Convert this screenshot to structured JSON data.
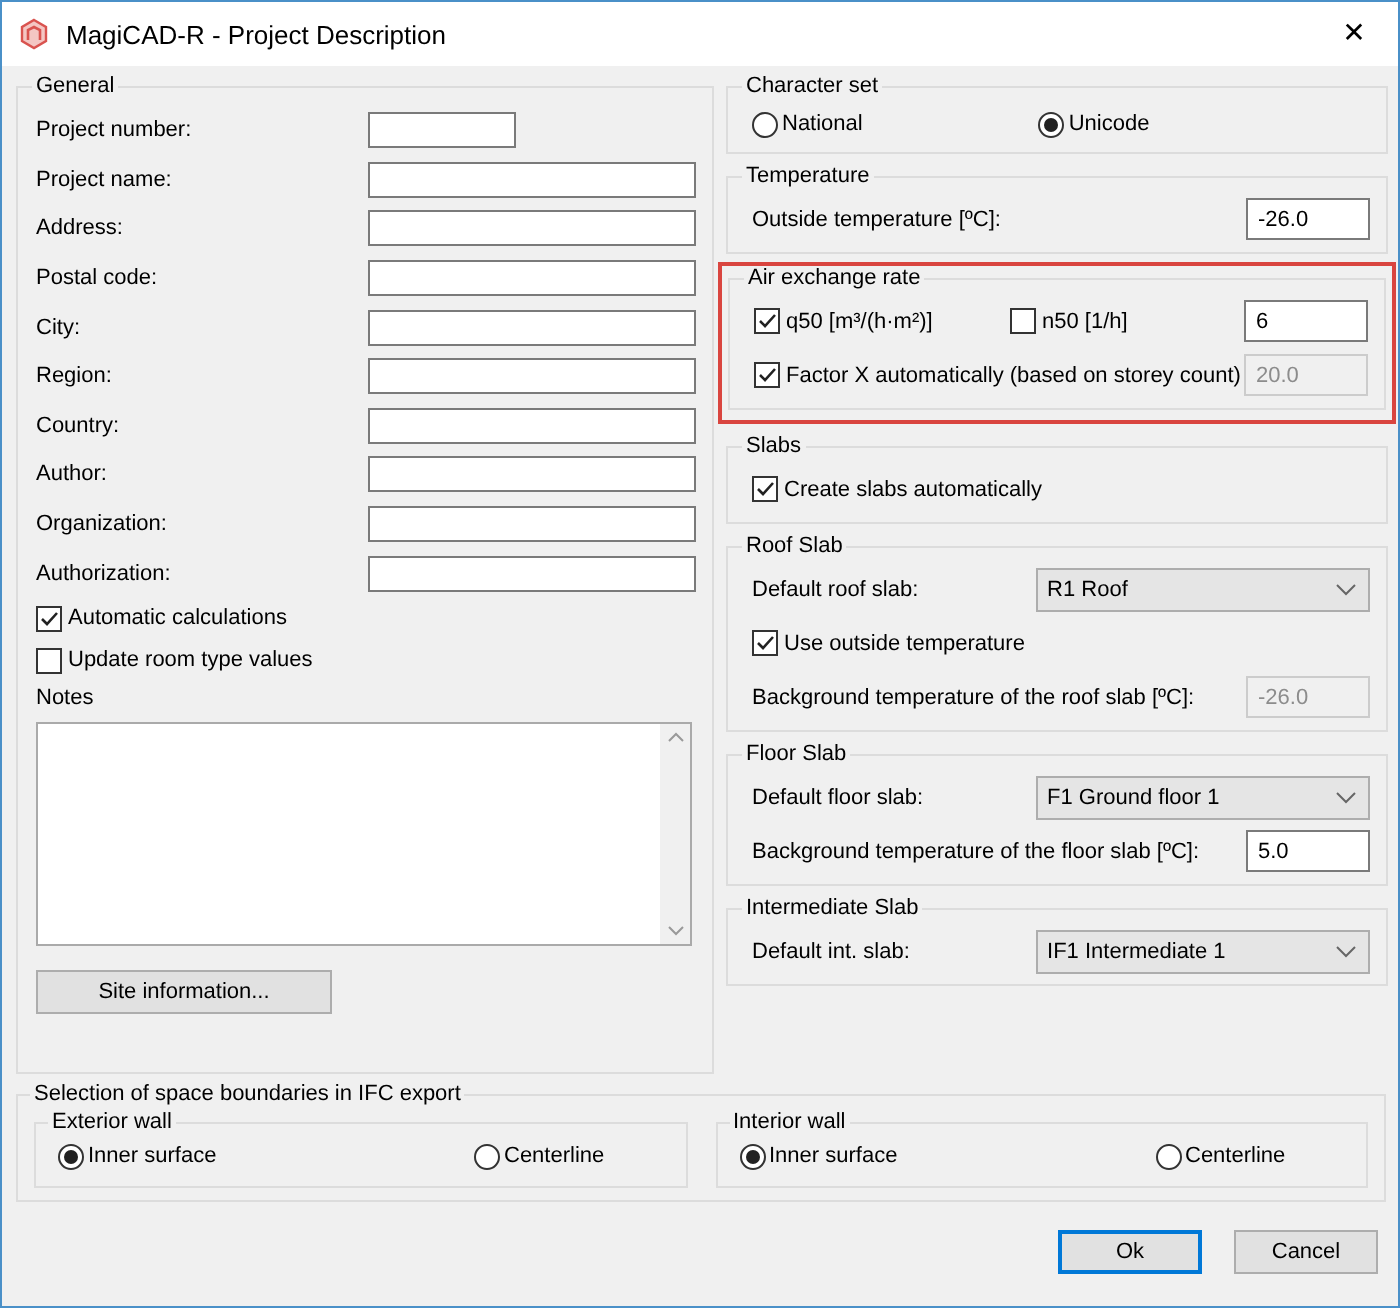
{
  "window": {
    "title": "MagiCAD-R - Project Description",
    "close": "✕"
  },
  "general": {
    "title": "General",
    "fields": [
      {
        "label": "Project number:",
        "short": true
      },
      {
        "label": "Project name:",
        "short": false
      },
      {
        "label": "Address:",
        "short": false
      },
      {
        "label": "Postal code:",
        "short": false
      },
      {
        "label": "City:",
        "short": false
      },
      {
        "label": "Region:",
        "short": false
      },
      {
        "label": "Country:",
        "short": false
      },
      {
        "label": "Author:",
        "short": false
      },
      {
        "label": "Organization:",
        "short": false
      },
      {
        "label": "Authorization:",
        "short": false
      }
    ],
    "checks": [
      {
        "label": "Automatic calculations",
        "checked": true
      },
      {
        "label": "Update room type values",
        "checked": false
      }
    ],
    "notes_label": "Notes",
    "site_button": "Site information..."
  },
  "groups": [
    {
      "title": "Character set",
      "highlighted": false,
      "rows": [
        {
          "kind": "radios",
          "options": [
            {
              "label": "National",
              "selected": false
            },
            {
              "label": "Unicode",
              "selected": true
            }
          ]
        }
      ]
    },
    {
      "title": "Temperature",
      "highlighted": false,
      "rows": [
        {
          "kind": "field",
          "label": "Outside temperature [ºC]:",
          "value": "-26.0",
          "disabled": false
        }
      ]
    },
    {
      "title": "Air exchange rate",
      "highlighted": true,
      "rows": [
        {
          "kind": "checks-field",
          "checks": [
            {
              "label": "q50 [m³/(h·m²)]",
              "checked": true
            },
            {
              "label": "n50 [1/h]",
              "checked": false
            }
          ],
          "value": "6",
          "disabled": false
        },
        {
          "kind": "check-field",
          "label": "Factor X automatically (based on storey count)",
          "checked": true,
          "value": "20.0",
          "disabled": true
        }
      ]
    },
    {
      "title": "Slabs",
      "highlighted": false,
      "rows": [
        {
          "kind": "check",
          "label": "Create slabs automatically",
          "checked": true
        }
      ]
    },
    {
      "title": "Roof Slab",
      "highlighted": false,
      "rows": [
        {
          "kind": "select",
          "label": "Default roof slab:",
          "value": "R1 Roof"
        },
        {
          "kind": "check",
          "label": "Use outside temperature",
          "checked": true
        },
        {
          "kind": "field",
          "label": "Background temperature of the roof slab [ºC]:",
          "value": "-26.0",
          "disabled": true
        }
      ]
    },
    {
      "title": "Floor Slab",
      "highlighted": false,
      "rows": [
        {
          "kind": "select",
          "label": "Default floor slab:",
          "value": "F1 Ground floor 1"
        },
        {
          "kind": "field",
          "label": "Background temperature of the floor slab [ºC]:",
          "value": "5.0",
          "disabled": false
        }
      ]
    },
    {
      "title": "Intermediate Slab",
      "highlighted": false,
      "rows": [
        {
          "kind": "select",
          "label": "Default int. slab:",
          "value": "IF1 Intermediate 1"
        }
      ]
    }
  ],
  "ifc": {
    "title": "Selection of space boundaries in IFC export",
    "walls": [
      {
        "title": "Exterior wall",
        "options": [
          {
            "label": "Inner surface",
            "selected": true
          },
          {
            "label": "Centerline",
            "selected": false
          }
        ]
      },
      {
        "title": "Interior wall",
        "options": [
          {
            "label": "Inner surface",
            "selected": true
          },
          {
            "label": "Centerline",
            "selected": false
          }
        ]
      }
    ]
  },
  "buttons": [
    {
      "label": "Ok",
      "default": true
    },
    {
      "label": "Cancel",
      "default": false
    }
  ]
}
